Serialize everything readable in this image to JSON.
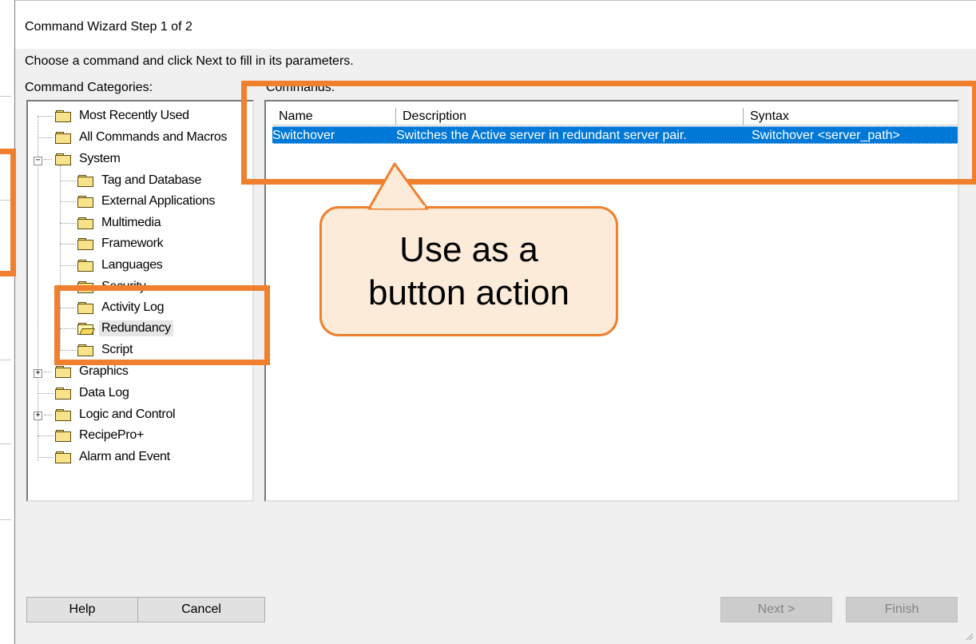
{
  "dialog": {
    "title": "Command Wizard Step 1 of 2",
    "instruction": "Choose a command and click Next to fill in its parameters.",
    "categories_label": "Command Categories:",
    "commands_label": "Commands:"
  },
  "tree": [
    {
      "label": "Most Recently Used"
    },
    {
      "label": "All Commands and Macros"
    },
    {
      "label": "System",
      "expander": "−"
    },
    {
      "label": "Tag and Database"
    },
    {
      "label": "External Applications"
    },
    {
      "label": "Multimedia"
    },
    {
      "label": "Framework"
    },
    {
      "label": "Languages"
    },
    {
      "label": "Security"
    },
    {
      "label": "Activity Log"
    },
    {
      "label": "Redundancy",
      "selected": true
    },
    {
      "label": "Script"
    },
    {
      "label": "Graphics",
      "expander": "+"
    },
    {
      "label": "Data Log"
    },
    {
      "label": "Logic and Control",
      "expander": "+"
    },
    {
      "label": "RecipePro+"
    },
    {
      "label": "Alarm and Event"
    }
  ],
  "commands": {
    "columns": [
      "Name",
      "Description",
      "Syntax"
    ],
    "rows": [
      {
        "name": "Switchover",
        "description": "Switches the Active server in redundant server pair.",
        "syntax": "Switchover <server_path>"
      }
    ]
  },
  "buttons": {
    "help": "Help",
    "cancel": "Cancel",
    "next": "Next >",
    "finish": "Finish"
  },
  "annotation": {
    "line1": "Use as a",
    "line2": "button action",
    "accent_color": "#f07f2e",
    "fill_color": "#fcebd9"
  },
  "colors": {
    "selection": "#0078d7",
    "dialog_bg": "#f0f0f0"
  }
}
